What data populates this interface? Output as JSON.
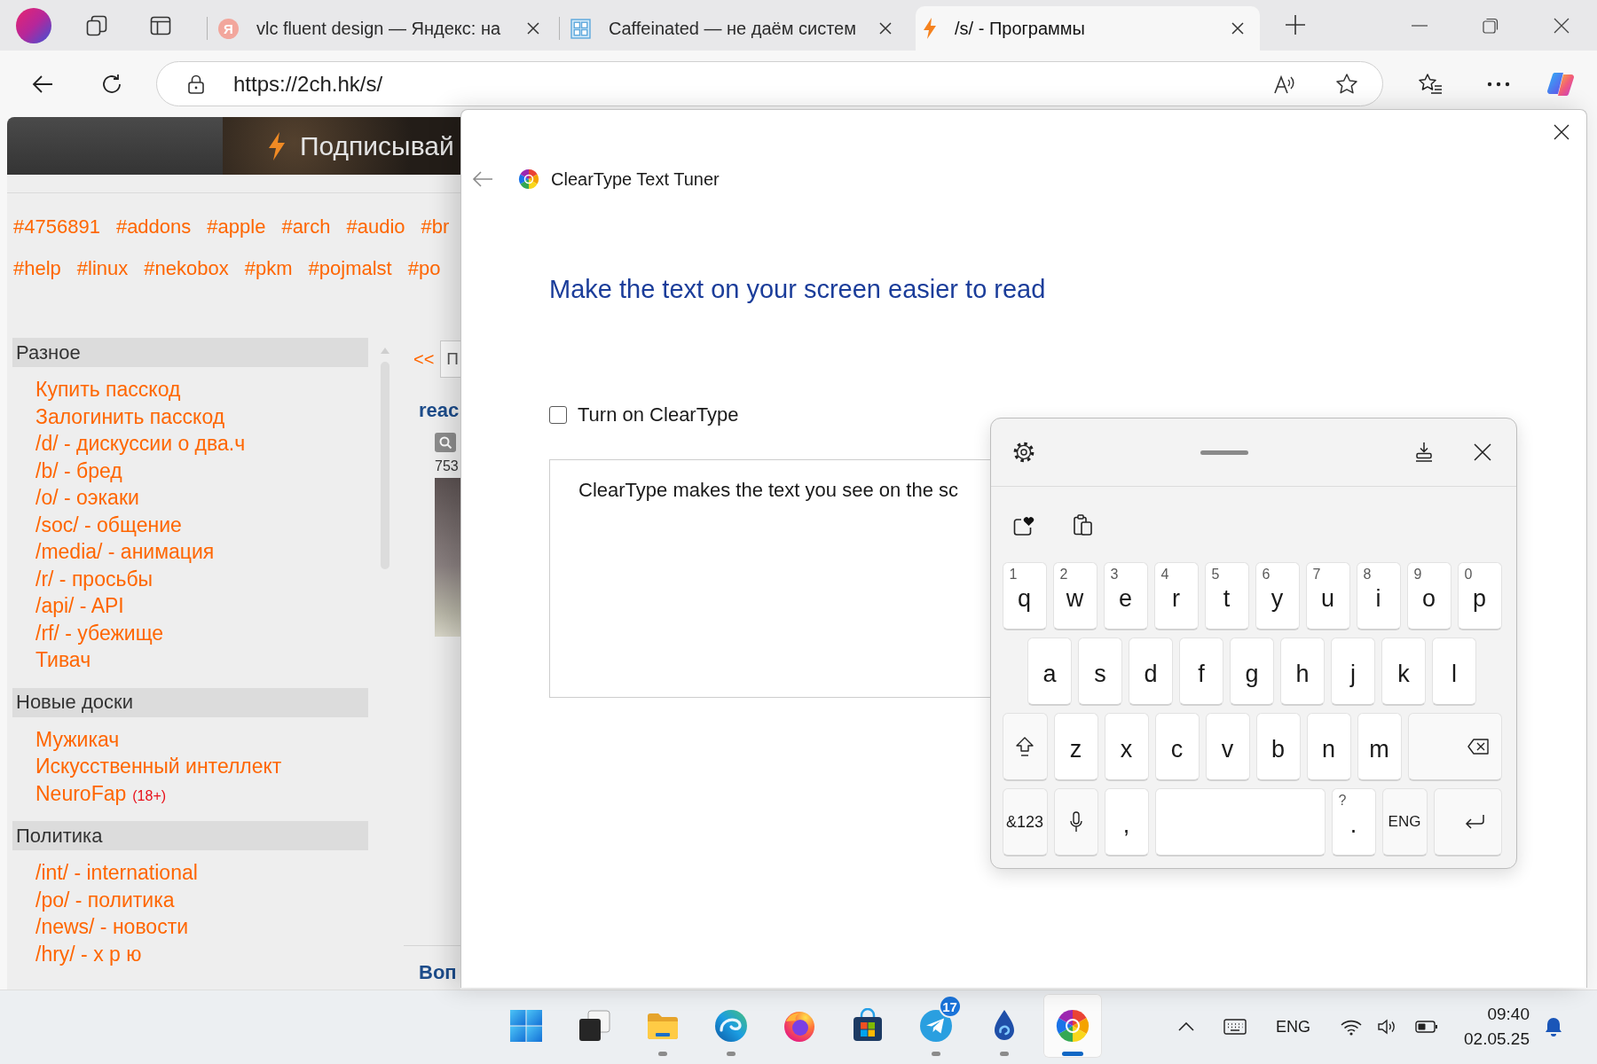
{
  "browser": {
    "tabs": [
      {
        "kind": "letter",
        "icon_text": "Я",
        "title": "vlc fluent design — Яндекс: на",
        "selected": false
      },
      {
        "kind": "grid",
        "title": "Caffeinated — не даём систем",
        "selected": false
      },
      {
        "kind": "bolt",
        "title": "/s/ - Программы",
        "selected": true
      }
    ],
    "url": "https://2ch.hk/s/"
  },
  "page": {
    "banner": "Подписывай",
    "tag_rows": [
      [
        "#4756891",
        "#addons",
        "#apple",
        "#arch",
        "#audio",
        "#br"
      ],
      [
        "#help",
        "#linux",
        "#nekobox",
        "#pkm",
        "#pojmalst",
        "#po"
      ]
    ],
    "sections": [
      {
        "title": "Разное",
        "items": [
          {
            "label": "Купить пасскод"
          },
          {
            "label": "Залогинить пасскод"
          },
          {
            "label": "/d/ - дискуссии о два.ч"
          },
          {
            "label": "/b/ - бред"
          },
          {
            "label": "/o/ - оэкаки"
          },
          {
            "label": "/soc/ - общение"
          },
          {
            "label": "/media/ - анимация"
          },
          {
            "label": "/r/ - просьбы"
          },
          {
            "label": "/api/ - API"
          },
          {
            "label": "/rf/ - убежище"
          },
          {
            "label": "Тивач"
          }
        ]
      },
      {
        "title": "Новые доски",
        "items": [
          {
            "label": "Мужикач"
          },
          {
            "label": "Искусственный интеллект"
          },
          {
            "label": "NeuroFap",
            "badge": "(18+)"
          }
        ]
      },
      {
        "title": "Политика",
        "items": [
          {
            "label": "/int/ - international"
          },
          {
            "label": "/po/ - политика"
          },
          {
            "label": "/news/ - новости"
          },
          {
            "label": "/hry/ - х р ю"
          }
        ]
      }
    ],
    "pager": "<<",
    "filter_field": {
      "value": "П"
    },
    "thread": {
      "title": "reac",
      "file_info": "753"
    },
    "next_thread_title": "Воп"
  },
  "dialog": {
    "title": "ClearType Text Tuner",
    "heading": "Make the text on your screen easier to read",
    "checkbox": {
      "label": "Turn on ClearType",
      "checked": false
    },
    "description": "ClearType makes the text you see on the sc"
  },
  "keyboard": {
    "rows": [
      [
        {
          "kind": "letter",
          "label": "q",
          "hint": "1"
        },
        {
          "kind": "letter",
          "label": "w",
          "hint": "2"
        },
        {
          "kind": "letter",
          "label": "e",
          "hint": "3"
        },
        {
          "kind": "letter",
          "label": "r",
          "hint": "4"
        },
        {
          "kind": "letter",
          "label": "t",
          "hint": "5"
        },
        {
          "kind": "letter",
          "label": "y",
          "hint": "6"
        },
        {
          "kind": "letter",
          "label": "u",
          "hint": "7"
        },
        {
          "kind": "letter",
          "label": "i",
          "hint": "8"
        },
        {
          "kind": "letter",
          "label": "o",
          "hint": "9"
        },
        {
          "kind": "letter",
          "label": "p",
          "hint": "0"
        }
      ],
      [
        {
          "kind": "letter",
          "label": "a"
        },
        {
          "kind": "letter",
          "label": "s"
        },
        {
          "kind": "letter",
          "label": "d"
        },
        {
          "kind": "letter",
          "label": "f"
        },
        {
          "kind": "letter",
          "label": "g"
        },
        {
          "kind": "letter",
          "label": "h"
        },
        {
          "kind": "letter",
          "label": "j"
        },
        {
          "kind": "letter",
          "label": "k"
        },
        {
          "kind": "letter",
          "label": "l"
        }
      ],
      [
        {
          "kind": "shift"
        },
        {
          "kind": "letter",
          "label": "z"
        },
        {
          "kind": "letter",
          "label": "x"
        },
        {
          "kind": "letter",
          "label": "c"
        },
        {
          "kind": "letter",
          "label": "v"
        },
        {
          "kind": "letter",
          "label": "b"
        },
        {
          "kind": "letter",
          "label": "n"
        },
        {
          "kind": "letter",
          "label": "m"
        },
        {
          "kind": "backspace"
        }
      ],
      [
        {
          "kind": "symbols",
          "label": "&123"
        },
        {
          "kind": "mic"
        },
        {
          "kind": "letter",
          "label": ","
        },
        {
          "kind": "space"
        },
        {
          "kind": "letter",
          "label": ".",
          "hint": "?"
        },
        {
          "kind": "language",
          "label": "ENG"
        },
        {
          "kind": "enter"
        }
      ]
    ]
  },
  "taskbar": {
    "apps": [
      {
        "kind": "start",
        "running": false,
        "selected": false
      },
      {
        "kind": "task_view",
        "running": false,
        "selected": false
      },
      {
        "kind": "files",
        "running": true,
        "selected": false
      },
      {
        "kind": "edge",
        "running": true,
        "selected": false
      },
      {
        "kind": "firefox",
        "running": false,
        "selected": false
      },
      {
        "kind": "store",
        "running": false,
        "selected": false
      },
      {
        "kind": "telegram",
        "running": true,
        "selected": false,
        "badge": "17"
      },
      {
        "kind": "drop",
        "running": true,
        "selected": false
      },
      {
        "kind": "cleartype",
        "running": true,
        "selected": true
      }
    ],
    "tray": {
      "language": "ENG",
      "time": "09:40",
      "date": "02.05.25"
    }
  }
}
